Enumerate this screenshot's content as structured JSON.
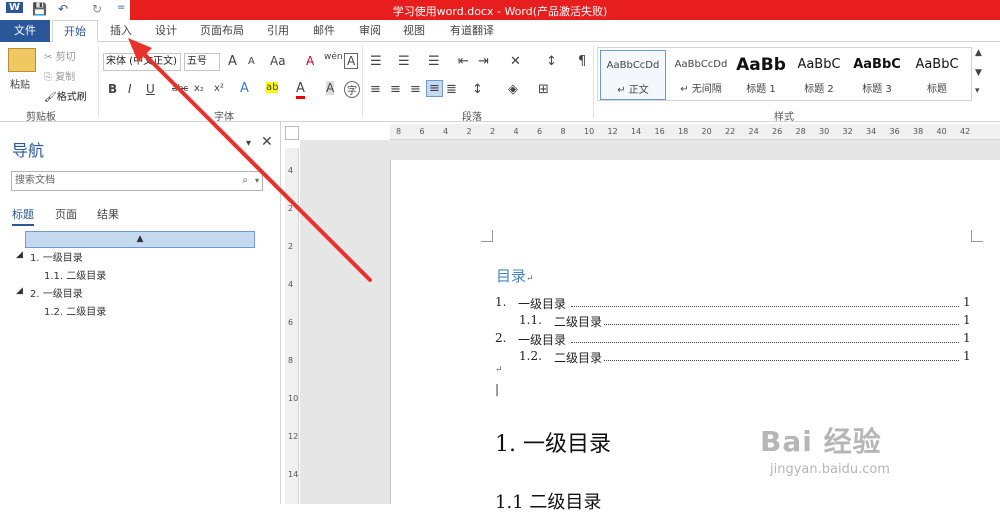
{
  "window": {
    "title": "学习使用word.docx - Word(产品激活失败)"
  },
  "qat": {
    "word_icon": "W",
    "save": "💾",
    "undo": "↶",
    "redo": "↻",
    "more": "="
  },
  "tabs": [
    "文件",
    "开始",
    "插入",
    "设计",
    "页面布局",
    "引用",
    "邮件",
    "审阅",
    "视图",
    "有道翻译"
  ],
  "clipboard": {
    "paste": "粘贴",
    "cut": "剪切",
    "copy": "复制",
    "format_painter": "格式刷",
    "label": "剪贴板"
  },
  "font": {
    "family": "宋体 (中文正文)",
    "size": "五号",
    "grow": "A",
    "shrink": "A",
    "change_case": "Aa",
    "clear": "A",
    "pinyin": "wén",
    "border": "A",
    "bold": "B",
    "italic": "I",
    "underline": "U",
    "strike": "abc",
    "sub": "x₂",
    "sup": "x²",
    "effects": "A",
    "highlight": "ab",
    "color": "A",
    "ruby": "A",
    "circle": "字",
    "label": "字体"
  },
  "paragraph": {
    "label": "段落"
  },
  "styles": {
    "items": [
      {
        "preview": "AaBbCcDd",
        "label": "正文"
      },
      {
        "preview": "AaBbCcDd",
        "label": "无间隔"
      },
      {
        "preview": "AaBb",
        "label": "标题 1"
      },
      {
        "preview": "AaBbC",
        "label": "标题 2"
      },
      {
        "preview": "AaBbC",
        "label": "标题 3"
      },
      {
        "preview": "AaBbC",
        "label": "标题"
      }
    ],
    "label": "样式"
  },
  "nav": {
    "title": "导航",
    "search_placeholder": "搜索文档",
    "tabs": [
      "标题",
      "页面",
      "结果"
    ],
    "collapse": "▲",
    "tree": [
      {
        "text": "1. 一级目录",
        "level": 1
      },
      {
        "text": "1.1. 二级目录",
        "level": 2
      },
      {
        "text": "2. 一级目录",
        "level": 1
      },
      {
        "text": "1.2. 二级目录",
        "level": 2
      }
    ]
  },
  "hruler": [
    "8",
    "6",
    "4",
    "2",
    "2",
    "4",
    "6",
    "8",
    "10",
    "12",
    "14",
    "16",
    "18",
    "20",
    "22",
    "24",
    "26",
    "28",
    "30",
    "32",
    "34",
    "36",
    "38",
    "40",
    "42"
  ],
  "vruler": [
    "4",
    "2",
    "2",
    "4",
    "6",
    "8",
    "10",
    "12",
    "14"
  ],
  "doc": {
    "toc_title": "目录",
    "toc": [
      {
        "num": "1.",
        "text": "一级目录",
        "page": "1"
      },
      {
        "num": "1.1.",
        "text": "二级目录",
        "page": "1"
      },
      {
        "num": "2.",
        "text": "一级目录",
        "page": "1"
      },
      {
        "num": "1.2.",
        "text": "二级目录",
        "page": "1"
      }
    ],
    "heading1": "1. 一级目录",
    "heading2": "1.1 二级目录"
  },
  "watermark": {
    "main": "Bai 经验",
    "sub": "jingyan.baidu.com"
  }
}
